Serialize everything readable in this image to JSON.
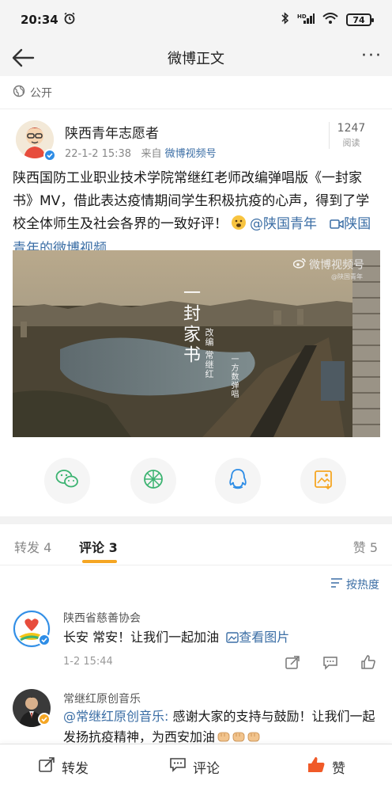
{
  "status_bar": {
    "time": "20:34",
    "battery": "74"
  },
  "nav": {
    "title": "微博正文"
  },
  "visibility": "公开",
  "author": {
    "name": "陕西青年志愿者",
    "time": "22-1-2 15:38",
    "source_prefix": "来自",
    "source": "微博视频号",
    "read_count": "1247",
    "read_label": "阅读"
  },
  "post": {
    "text": "陕西国防工业职业技术学院常继红老师改编弹唱版《一封家书》MV，借此表达疫情期间学生积极抗疫的心声，得到了学校全体师生及社会各界的一致好评！",
    "mention": "@陕国青年",
    "video_link": "陕国青年的微博视频"
  },
  "media": {
    "watermark": "微博视频号",
    "watermark_sub": "@陕国青年",
    "title": "一封家书",
    "credit_line1": "改编 常继红",
    "credit_line2": "一方数弹唱"
  },
  "share_icons": [
    "wechat-icon",
    "moments-icon",
    "qq-icon",
    "save-image-icon"
  ],
  "tabs": [
    {
      "label": "转发",
      "count": "4"
    },
    {
      "label": "评论",
      "count": "3"
    },
    {
      "label": "赞",
      "count": "5"
    }
  ],
  "sort_label": "按热度",
  "comments": [
    {
      "name": "陕西省慈善协会",
      "text": "长安 常安！让我们一起加油",
      "image_link": "查看图片",
      "time": "1-2 15:44"
    },
    {
      "name": "常继红原创音乐",
      "mention": "@常继红原创音乐:",
      "text": "感谢大家的支持与鼓励！让我们一起发扬抗疫精神，为西安加油"
    }
  ],
  "bottom_bar": {
    "repost": "转发",
    "comment": "评论",
    "like": "赞"
  },
  "colors": {
    "link": "#3b6ea5",
    "accent": "#f5a623",
    "like": "#f05a28",
    "verify": "#2e8de6",
    "verify_gold": "#f5a623"
  }
}
